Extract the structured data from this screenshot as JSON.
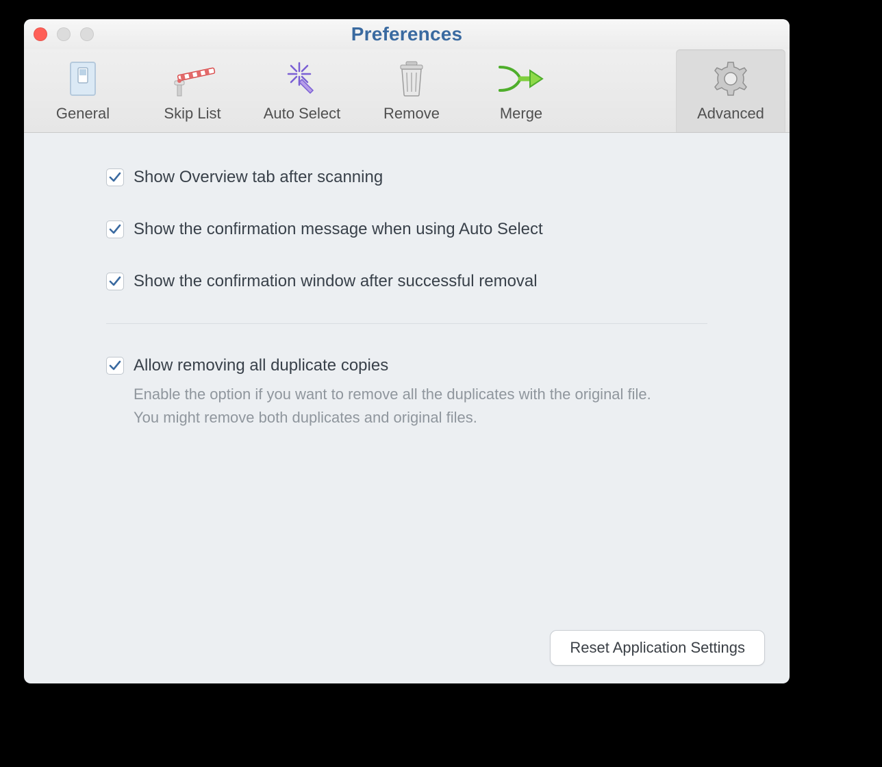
{
  "window": {
    "title": "Preferences"
  },
  "toolbar": {
    "tabs": [
      {
        "label": "General"
      },
      {
        "label": "Skip List"
      },
      {
        "label": "Auto Select"
      },
      {
        "label": "Remove"
      },
      {
        "label": "Merge"
      },
      {
        "label": "Advanced"
      }
    ],
    "active_index": 5
  },
  "options": {
    "show_overview": {
      "checked": true,
      "label": "Show Overview tab after scanning"
    },
    "confirm_autoselect": {
      "checked": true,
      "label": "Show the confirmation message when using Auto Select"
    },
    "confirm_removal": {
      "checked": true,
      "label": "Show the confirmation window after successful removal"
    },
    "allow_remove_all": {
      "checked": true,
      "label": "Allow removing all duplicate copies",
      "help_line1": "Enable the option if you want to remove all the duplicates with the original file.",
      "help_line2": "You might remove both duplicates and original files."
    }
  },
  "footer": {
    "reset_label": "Reset Application Settings"
  }
}
